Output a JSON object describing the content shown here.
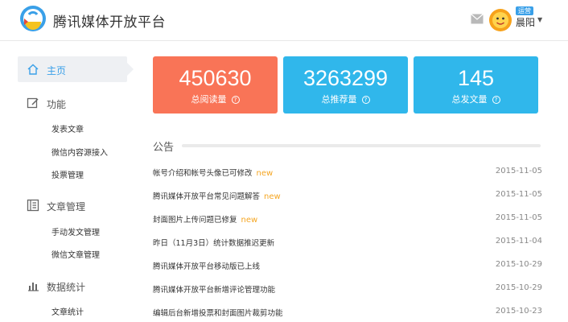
{
  "header": {
    "brand": "腾讯媒体开放平台",
    "user": {
      "name": "晨阳",
      "badge": "运营"
    }
  },
  "sidebar": {
    "home": "主页",
    "sections": [
      {
        "label": "功能",
        "icon": "edit-icon",
        "items": [
          "发表文章",
          "微信内容源接入",
          "投票管理"
        ]
      },
      {
        "label": "文章管理",
        "icon": "document-icon",
        "items": [
          "手动发文管理",
          "微信文章管理"
        ]
      },
      {
        "label": "数据统计",
        "icon": "bar-chart-icon",
        "items": [
          "文章统计"
        ]
      }
    ]
  },
  "stats": [
    {
      "value": "450630",
      "label": "总阅读量",
      "color": "#f97457"
    },
    {
      "value": "3263299",
      "label": "总推荐量",
      "color": "#30b7eb"
    },
    {
      "value": "145",
      "label": "总发文量",
      "color": "#30b7eb"
    }
  ],
  "notice": {
    "title": "公告",
    "rows": [
      {
        "title": "帐号介绍和帐号头像已可修改",
        "new": "new",
        "date": "2015-11-05"
      },
      {
        "title": "腾讯媒体开放平台常见问题解答",
        "new": "new",
        "date": "2015-11-05"
      },
      {
        "title": "封面图片上传问题已修复",
        "new": "new",
        "date": "2015-11-05"
      },
      {
        "title": "昨日（11月3日）统计数据推迟更新",
        "new": "",
        "date": "2015-11-04"
      },
      {
        "title": "腾讯媒体开放平台移动版已上线",
        "new": "",
        "date": "2015-10-29"
      },
      {
        "title": "腾讯媒体开放平台新增评论管理功能",
        "new": "",
        "date": "2015-10-29"
      },
      {
        "title": "编辑后台新增投票和封面图片裁剪功能",
        "new": "",
        "date": "2015-10-23"
      }
    ]
  },
  "colors": {
    "accent": "#3aa0e8",
    "new_tag": "#f5a623"
  }
}
